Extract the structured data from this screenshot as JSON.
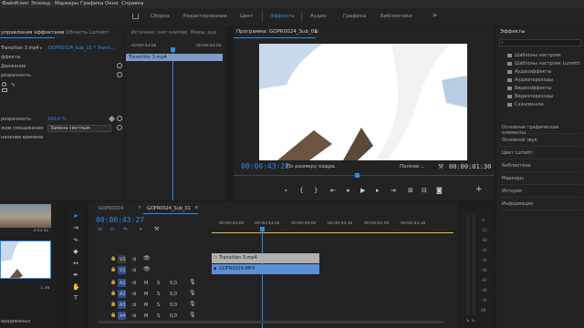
{
  "menu": [
    "Файл",
    "Клип",
    "Эпизод",
    "Маркеры",
    "Графика",
    "Окно",
    "Справка"
  ],
  "workspaces": [
    "Сборка",
    "Редактирование",
    "Цвет",
    "Эффекты",
    "Аудио",
    "Графика",
    "Библиотеки"
  ],
  "workspace_overflow": "»",
  "active_workspace": "Эффекты",
  "left_panel": {
    "tab_effect_controls": "управления эффектами",
    "tab_lumetri": "Область Lumetri",
    "tab_source": "Источник: (нет клипов)",
    "tab_mixer": "Микш. ауд",
    "crumb_source": "Transition 3.mp4",
    "crumb_sep": "▸",
    "crumb_seq": "GOPR0024_Sub_01 * Transi...",
    "mini_ruler": [
      "00:00:43:00",
      "00:00:44:00"
    ],
    "mini_clip": "Transition 3.mp4",
    "section_effects": "ффекты",
    "row_motion": "Движение",
    "row_opacity": "розрачность",
    "opacity_label": "розрачность",
    "opacity_value": "100,0 %",
    "blend_label": "жим смешивания",
    "blend_value": "Замена светлым",
    "remap_label": "наление времени"
  },
  "program": {
    "title": "Программа: GOPR0024_Sub_01",
    "timecode": "00:00:43:28",
    "fit": "По размеру кадра",
    "quality": "Полное",
    "duration": "00:00:01:30"
  },
  "effects_panel": {
    "title": "Эффекты",
    "search_placeholder": "",
    "bins": [
      "Шаблоны настроек",
      "Шаблоны настроек Lumetri",
      "Аудиоэффекты",
      "Аудиопереходы",
      "Видеоэффекты",
      "Видеопереходы",
      "Сканленное"
    ],
    "panels": [
      "Основные графические элементы",
      "Основной звук",
      "Цвет Lumetri",
      "Библиотеки",
      "Маркеры",
      "История",
      "Информация"
    ]
  },
  "project": {
    "thumb1_time": "3:43:02",
    "thumb2_time": "1:38",
    "bottom_label": "ерадиваных"
  },
  "timeline": {
    "tab1": "GOPR0024",
    "tab2": "GOPR0024_Sub_01",
    "timecode": "00:00:43:27",
    "ruler": [
      "00:00:43:00",
      "00:00:43:30",
      "00:00:44:00",
      "00:00:44:30",
      "00:00:45:00",
      "00:00:45:30"
    ],
    "tracks": [
      {
        "id": "V2",
        "type": "video"
      },
      {
        "id": "V1",
        "type": "video"
      },
      {
        "id": "A1",
        "type": "audio"
      },
      {
        "id": "A2",
        "type": "audio"
      },
      {
        "id": "A3",
        "type": "audio"
      },
      {
        "id": "A4",
        "type": "audio"
      }
    ],
    "clip_v2": "Transition 3.mp4",
    "clip_v1": "GOPR0024.MP4",
    "track_mute": "M",
    "track_solo": "S",
    "audio_value": "0,0"
  },
  "meter": {
    "scale": [
      "-6",
      "-12",
      "-18",
      "-24",
      "-30",
      "-36",
      "-42",
      "-48",
      "-54",
      "dB"
    ],
    "solo_labels": [
      "S",
      "S"
    ]
  },
  "colors": {
    "accent": "#2d8ceb",
    "panel": "#232323",
    "bg": "#1d1d1d",
    "clip_fx": "#b0b0b0",
    "clip_video": "#5b8fd6"
  }
}
